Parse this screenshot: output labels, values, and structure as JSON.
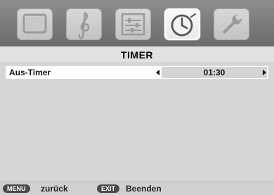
{
  "tabs": [
    {
      "icon": "tv-screen-icon",
      "active": false
    },
    {
      "icon": "treble-clef-icon",
      "active": false
    },
    {
      "icon": "settings-sliders-icon",
      "active": false
    },
    {
      "icon": "clock-icon",
      "active": true
    },
    {
      "icon": "wrench-icon",
      "active": false
    }
  ],
  "menu": {
    "title": "TIMER",
    "rows": [
      {
        "label": "Aus-Timer",
        "value": "01:30"
      }
    ]
  },
  "footer": {
    "menu_key": "MENU",
    "menu_hint": "zurück",
    "exit_key": "EXIT",
    "exit_hint": "Beenden"
  },
  "colors": {
    "accent_active_tab": "#ffffff",
    "background": "#d6d6d6",
    "selected_row": "#ffffff",
    "value_box": "#d4d4d4"
  }
}
